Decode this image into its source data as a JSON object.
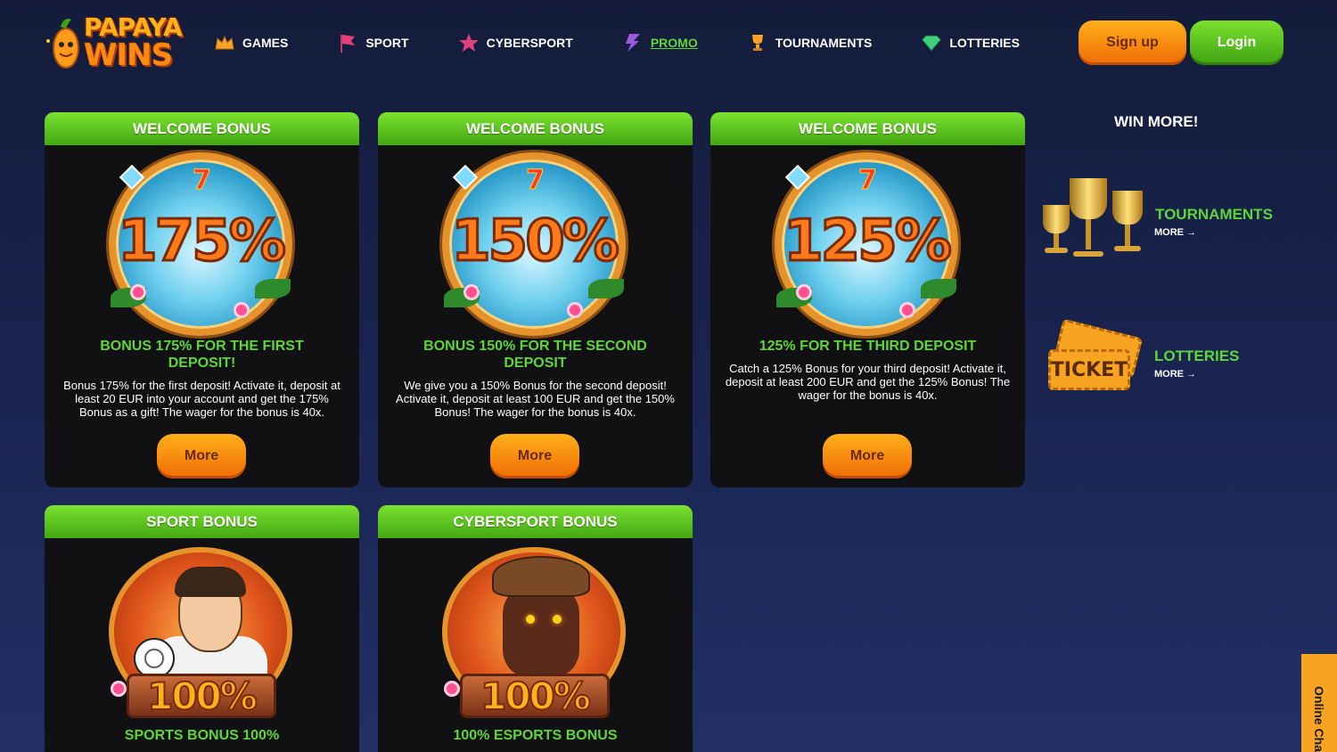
{
  "brand": {
    "line1": "PAPAYA",
    "line2": "WINS"
  },
  "nav": [
    {
      "label": "GAMES",
      "icon": "crown-icon",
      "active": false
    },
    {
      "label": "SPORT",
      "icon": "flag-icon",
      "active": false
    },
    {
      "label": "CYBERSPORT",
      "icon": "star-icon",
      "active": false
    },
    {
      "label": "PROMO",
      "icon": "lightning-icon",
      "active": true
    },
    {
      "label": "TOURNAMENTS",
      "icon": "trophy-icon",
      "active": false
    },
    {
      "label": "LOTTERIES",
      "icon": "diamond-icon",
      "active": false
    }
  ],
  "auth": {
    "signup": "Sign up",
    "login": "Login"
  },
  "cards": [
    {
      "header": "WELCOME BONUS",
      "art_text": "175%",
      "title": "BONUS 175% FOR THE FIRST DEPOSIT!",
      "description": "Bonus 175% for the first deposit! Activate it, deposit at least 20 EUR into your account and get the 175% Bonus as a gift! The wager for the bonus is 40x.",
      "button": "More"
    },
    {
      "header": "WELCOME BONUS",
      "art_text": "150%",
      "title": "BONUS 150% FOR THE SECOND DEPOSIT",
      "description": "We give you a 150% Bonus for the second deposit! Activate it, deposit at least 100 EUR and get the 150% Bonus! The wager for the bonus is 40x.",
      "button": "More"
    },
    {
      "header": "WELCOME BONUS",
      "art_text": "125%",
      "title": "125% FOR THE THIRD DEPOSIT",
      "description": "Catch a 125% Bonus for your third deposit! Activate it, deposit at least 200 EUR and get the 125% Bonus! The wager for the bonus is 40x.",
      "button": "More"
    },
    {
      "header": "SPORT BONUS",
      "art_text": "100%",
      "title": "SPORTS BONUS 100%"
    },
    {
      "header": "CYBERSPORT BONUS",
      "art_text": "100%",
      "title": "100% ESPORTS BONUS"
    }
  ],
  "sidebar": {
    "title": "WIN MORE!",
    "items": [
      {
        "label": "TOURNAMENTS",
        "more": "MORE →",
        "icon": "trophy-cups-icon"
      },
      {
        "label": "LOTTERIES",
        "more": "MORE →",
        "icon": "ticket-icon",
        "ticket_text": "TICKET"
      }
    ]
  },
  "chat": {
    "label": "Online Chat"
  },
  "colors": {
    "accent_green": "#5ed63a",
    "accent_orange": "#f06a06",
    "background": "#1a2552"
  }
}
